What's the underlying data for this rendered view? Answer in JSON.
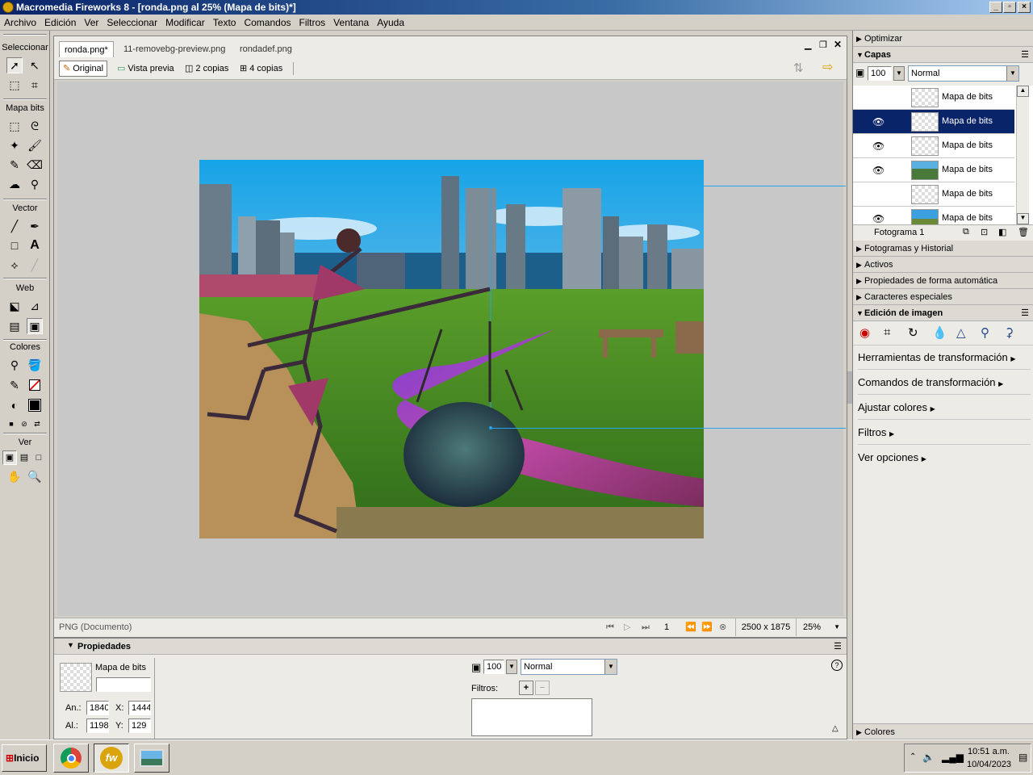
{
  "window": {
    "title": "Macromedia Fireworks 8 - [ronda.png al  25% (Mapa de bits)*]"
  },
  "menu": [
    "Archivo",
    "Edición",
    "Ver",
    "Seleccionar",
    "Modificar",
    "Texto",
    "Comandos",
    "Filtros",
    "Ventana",
    "Ayuda"
  ],
  "tools": {
    "select": "Seleccionar",
    "bitmap": "Mapa bits",
    "vector": "Vector",
    "web": "Web",
    "colors": "Colores",
    "view": "Ver"
  },
  "document": {
    "tabs": [
      {
        "label": "ronda.png*",
        "active": true
      },
      {
        "label": "11-removebg-preview.png"
      },
      {
        "label": "rondadef.png"
      }
    ],
    "views": {
      "original": "Original",
      "preview": "Vista previa",
      "two": "2 copias",
      "four": "4 copias"
    },
    "status": {
      "format": "PNG (Documento)",
      "frame": "1",
      "size": "2500 x 1875",
      "zoom": "25%"
    }
  },
  "properties": {
    "title": "Propiedades",
    "object": "Mapa de bits",
    "name_value": "",
    "w_label": "An.:",
    "w": "1840",
    "h_label": "Al.:",
    "h": "1198",
    "x_label": "X:",
    "x": "1444",
    "y_label": "Y:",
    "y": "129",
    "opacity": "100",
    "blend": "Normal",
    "filters_label": "Filtros:"
  },
  "panels": {
    "optimize": "Optimizar",
    "layers": {
      "title": "Capas",
      "opacity": "100",
      "blend": "Normal",
      "items": [
        "Mapa de bits",
        "Mapa de bits",
        "Mapa de bits",
        "Mapa de bits",
        "Mapa de bits",
        "Mapa de bits"
      ],
      "frame": "Fotograma 1"
    },
    "frames_history": "Fotogramas y Historial",
    "assets": "Activos",
    "autoshape": "Propiedades de forma automática",
    "special_chars": "Caracteres especiales",
    "image_edit": {
      "title": "Edición de imagen",
      "links": [
        "Herramientas de transformación",
        "Comandos de transformación",
        "Ajustar colores",
        "Filtros",
        "Ver opciones"
      ]
    },
    "colors": "Colores"
  },
  "taskbar": {
    "start": "Inicio",
    "time": "10:51 a.m.",
    "date": "10/04/2023"
  },
  "colors": {
    "accent": "#0a246a",
    "selection": "#0a246a"
  }
}
